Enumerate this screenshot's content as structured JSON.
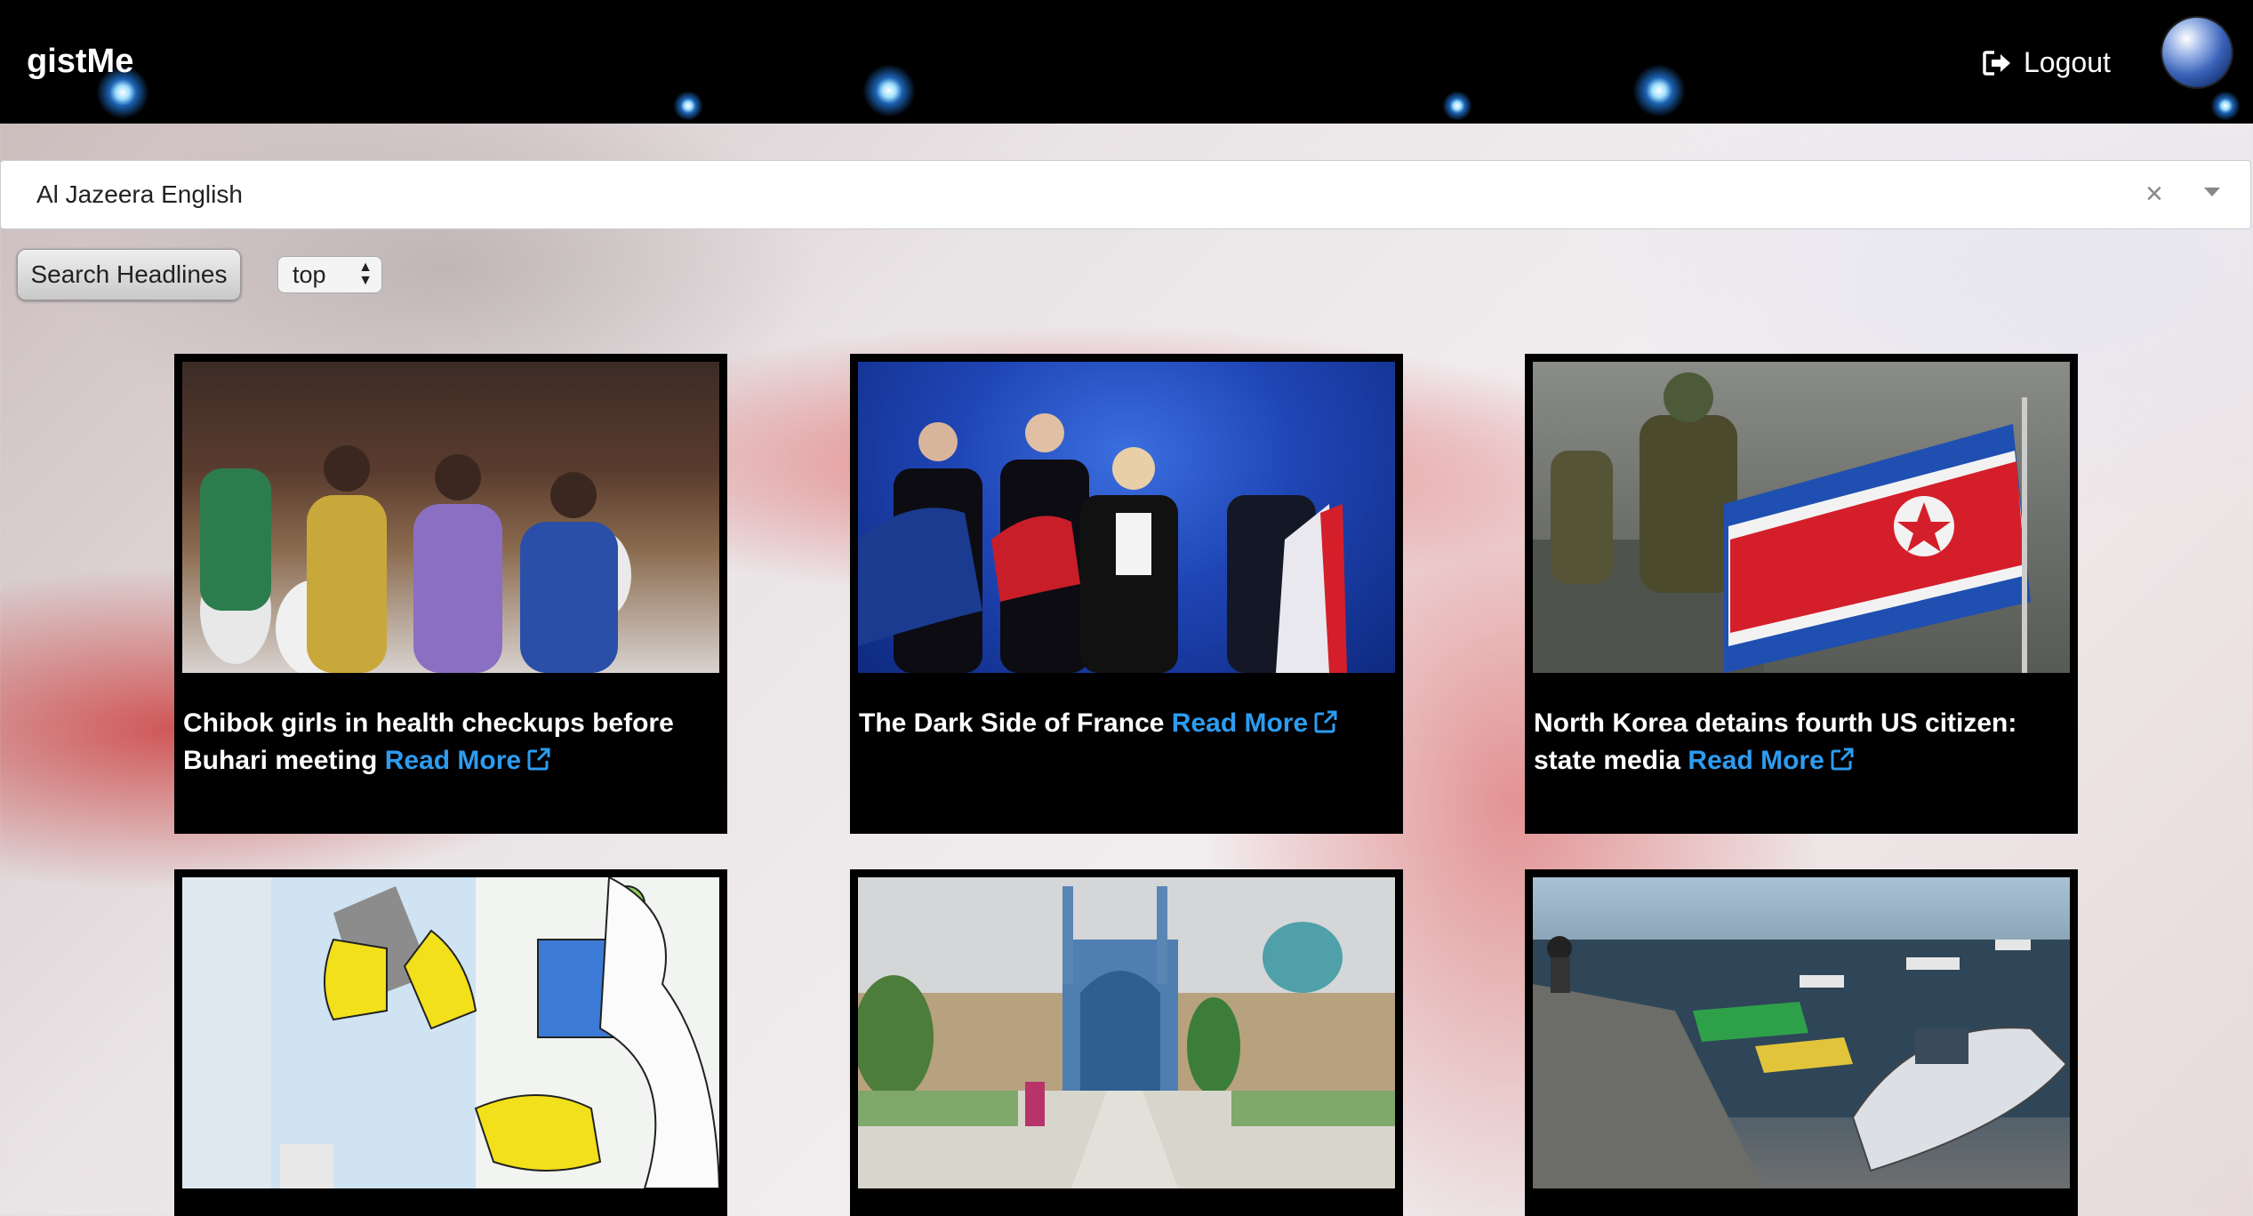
{
  "header": {
    "brand": "gistMe",
    "logout_label": "Logout"
  },
  "source_select": {
    "value": "Al Jazeera English",
    "clear_symbol": "×"
  },
  "controls": {
    "search_label": "Search Headlines",
    "sort_value": "top",
    "sort_arrows": "▴▾"
  },
  "articles": [
    {
      "title": "Chibok girls in health checkups before Buhari meeting",
      "link_label": "Read More",
      "image": "chibok-girls-photo"
    },
    {
      "title": "The Dark Side of France",
      "link_label": "Read More",
      "image": "le-pen-rally-photo"
    },
    {
      "title": "North Korea detains fourth US citizen: state media",
      "link_label": "Read More",
      "image": "north-korea-flag-photo"
    },
    {
      "title": "",
      "link_label": "",
      "image": "cleaning-illustration"
    },
    {
      "title": "",
      "link_label": "",
      "image": "isfahan-mosque-photo"
    },
    {
      "title": "",
      "link_label": "",
      "image": "fishing-boats-photo"
    }
  ]
}
